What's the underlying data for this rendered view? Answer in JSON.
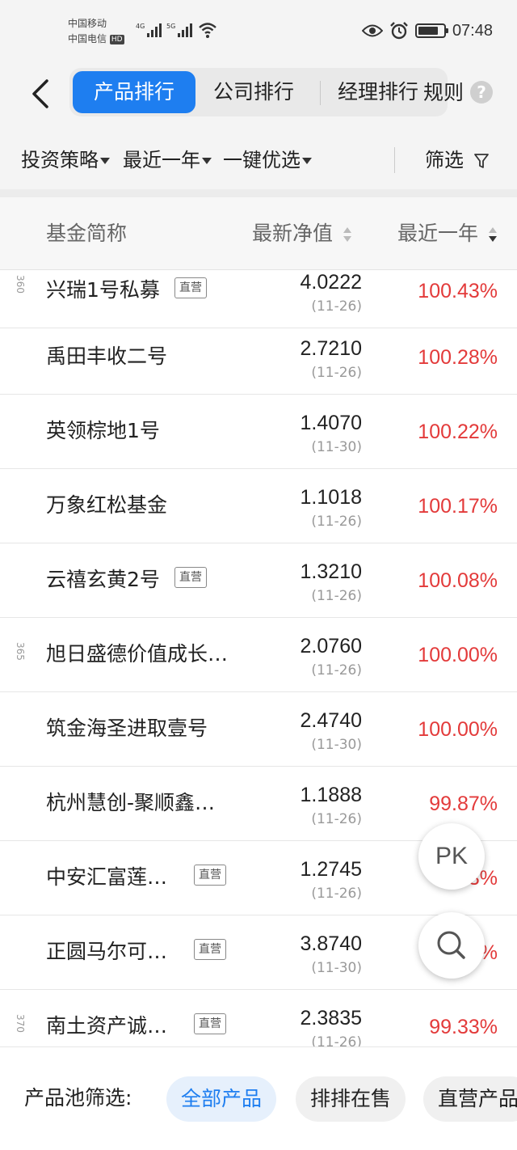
{
  "status_bar": {
    "carrier1": "中国移动",
    "carrier2": "中国电信",
    "hd": "HD",
    "sig1": "4G",
    "sig2": "5G",
    "time": "07:48"
  },
  "nav": {
    "tabs": [
      {
        "label": "产品排行",
        "active": true
      },
      {
        "label": "公司排行",
        "active": false
      },
      {
        "label": "经理排行",
        "active": false
      }
    ],
    "rules_label": "规则",
    "help_label": "?"
  },
  "filters": {
    "strategy": "投资策略",
    "period": "最近一年",
    "preset": "一键优选",
    "screen": "筛选"
  },
  "header": {
    "name": "基金简称",
    "nav": "最新净值",
    "ret": "最近一年"
  },
  "rows": [
    {
      "rank": "360",
      "name": "兴瑞1号私募",
      "tag": "直营",
      "nav": "4.0222",
      "date": "(11-26)",
      "ret": "100.43%"
    },
    {
      "rank": "",
      "name": "禹田丰收二号",
      "tag": "",
      "nav": "2.7210",
      "date": "(11-26)",
      "ret": "100.28%"
    },
    {
      "rank": "",
      "name": "英领棕地1号",
      "tag": "",
      "nav": "1.4070",
      "date": "(11-30)",
      "ret": "100.22%"
    },
    {
      "rank": "",
      "name": "万象红松基金",
      "tag": "",
      "nav": "1.1018",
      "date": "(11-26)",
      "ret": "100.17%"
    },
    {
      "rank": "",
      "name": "云禧玄黄2号",
      "tag": "直营",
      "nav": "1.3210",
      "date": "(11-26)",
      "ret": "100.08%"
    },
    {
      "rank": "365",
      "name": "旭日盛德价值成长…",
      "tag": "",
      "nav": "2.0760",
      "date": "(11-26)",
      "ret": "100.00%"
    },
    {
      "rank": "",
      "name": "筑金海圣进取壹号",
      "tag": "",
      "nav": "2.4740",
      "date": "(11-30)",
      "ret": "100.00%"
    },
    {
      "rank": "",
      "name": "杭州慧创-聚顺鑫…",
      "tag": "",
      "nav": "1.1888",
      "date": "(11-26)",
      "ret": "99.87%"
    },
    {
      "rank": "",
      "name": "中安汇富莲…",
      "tag": "直营",
      "nav": "1.2745",
      "date": "(11-26)",
      "ret": "…3%"
    },
    {
      "rank": "",
      "name": "正圆马尔可…",
      "tag": "直营",
      "nav": "3.8740",
      "date": "(11-30)",
      "ret": "…%"
    },
    {
      "rank": "370",
      "name": "南土资产诚…",
      "tag": "直营",
      "nav": "2.3835",
      "date": "(11-26)",
      "ret": "99.33%"
    }
  ],
  "fab": {
    "pk": "PK"
  },
  "bottom": {
    "label": "产品池筛选:",
    "chips": [
      "全部产品",
      "排排在售",
      "直营产品"
    ]
  },
  "colors": {
    "accent": "#1e7ef0",
    "positive": "#e33a3a"
  }
}
